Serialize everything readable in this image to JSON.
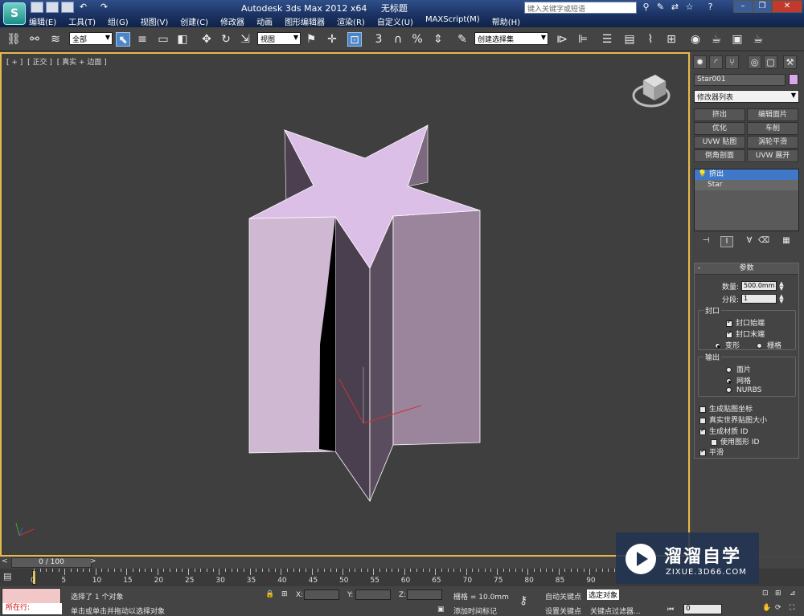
{
  "app": {
    "title": "Autodesk 3ds Max  2012 x64",
    "document": "无标题",
    "search_placeholder": "键入关键字或短语"
  },
  "menu": [
    "编辑(E)",
    "工具(T)",
    "组(G)",
    "视图(V)",
    "创建(C)",
    "修改器",
    "动画",
    "图形编辑器",
    "渲染(R)",
    "自定义(U)",
    "MAXScript(M)",
    "帮助(H)"
  ],
  "toolbar": {
    "selection_filter": "全部",
    "ref_coord": "视图",
    "named_selection": "创建选择集",
    "snap_3": "3",
    "percent_snap": "%"
  },
  "viewport": {
    "label": [
      "[ + ]",
      "[ 正交 ]",
      "[ 真实 + 边面 ]"
    ],
    "object_color": "#dcbfe6"
  },
  "command_panel": {
    "object_name": "Star001",
    "object_color": "#d9a8ea",
    "modifier_list": "修改器列表",
    "modifier_buttons": [
      "挤出",
      "编辑面片",
      "优化",
      "车削",
      "UVW 贴图",
      "涡轮平滑",
      "倒角剖面",
      "UVW 展开"
    ],
    "stack": [
      {
        "label": "挤出",
        "selected": true
      },
      {
        "label": "Star",
        "selected": false
      }
    ],
    "params": {
      "title": "参数",
      "amount_label": "数量:",
      "amount_value": "500.0mm",
      "segments_label": "分段:",
      "segments_value": "1",
      "capping_title": "封口",
      "cap_start": "封口始端",
      "cap_end": "封口末端",
      "morph": "变形",
      "grid": "栅格",
      "output_title": "输出",
      "out_patch": "面片",
      "out_mesh": "网格",
      "out_nurbs": "NURBS",
      "gen_map_coords": "生成贴图坐标",
      "real_world": "真实世界贴图大小",
      "gen_mat_ids": "生成材质 ID",
      "use_shape_ids": "使用图形 ID",
      "smooth": "平滑"
    }
  },
  "timeline": {
    "frame_display": "0 / 100",
    "ticks": [
      "0",
      "5",
      "10",
      "15",
      "20",
      "25",
      "30",
      "35",
      "40",
      "45",
      "50",
      "55",
      "60",
      "65",
      "70",
      "75",
      "80",
      "85",
      "90"
    ]
  },
  "status": {
    "maxscript_label": "所在行:",
    "selection_info": "选择了 1 个对象",
    "prompt": "单击或单击并拖动以选择对象",
    "x_label": "X:",
    "y_label": "Y:",
    "z_label": "Z:",
    "grid": "栅格 = 10.0mm",
    "add_time_tag": "添加时间标记",
    "auto_key": "自动关键点",
    "set_key": "设置关键点",
    "selected_label": "选定对象",
    "key_filters": "关键点过滤器...",
    "frame": "0"
  },
  "watermark": {
    "title": "溜溜自学",
    "url": "ZIXUE.3D66.COM"
  }
}
